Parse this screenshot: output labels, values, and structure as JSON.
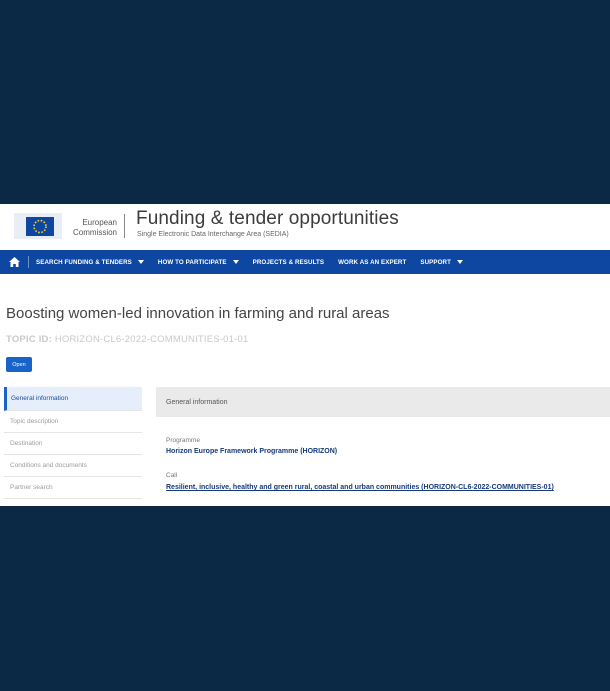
{
  "header": {
    "ec_line1": "European",
    "ec_line2": "Commission",
    "title": "Funding & tender opportunities",
    "subtitle": "Single Electronic Data Interchange Area (SEDIA)"
  },
  "nav": {
    "items": [
      {
        "label": "SEARCH FUNDING & TENDERS",
        "dropdown": true
      },
      {
        "label": "HOW TO PARTICIPATE",
        "dropdown": true
      },
      {
        "label": "PROJECTS & RESULTS",
        "dropdown": false
      },
      {
        "label": "WORK AS AN EXPERT",
        "dropdown": false
      },
      {
        "label": "SUPPORT",
        "dropdown": true
      }
    ]
  },
  "page": {
    "title": "Boosting women-led innovation in farming and rural areas",
    "topic_prefix": "TOPIC ID:",
    "topic_id": "HORIZON-CL6-2022-COMMUNITIES-01-01",
    "status_button": "Open"
  },
  "sidebar": {
    "items": [
      {
        "label": "General information",
        "active": true
      },
      {
        "label": "Topic description",
        "active": false
      },
      {
        "label": "Destination",
        "active": false
      },
      {
        "label": "Conditions and documents",
        "active": false
      },
      {
        "label": "Partner search",
        "active": false
      }
    ]
  },
  "main": {
    "section_title": "General information",
    "programme_label": "Programme",
    "programme_value": "Horizon Europe Framework Programme (HORIZON)",
    "call_label": "Call",
    "call_value": "Resilient, inclusive, healthy and green rural, coastal and urban communities (HORIZON-CL6-2022-COMMUNITIES-01)"
  },
  "colors": {
    "background": "#0b2945",
    "nav": "#0e47a1",
    "accent": "#1763c7"
  }
}
